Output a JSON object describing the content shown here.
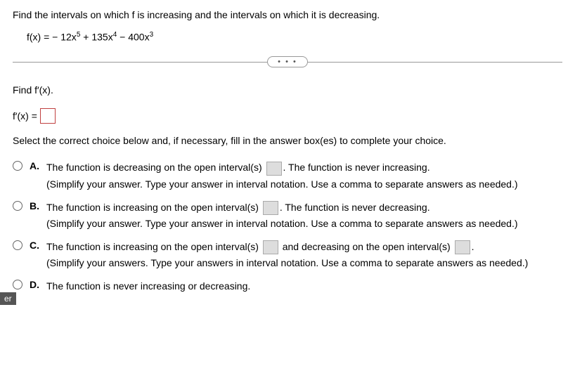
{
  "intro": "Find the intervals on which f is increasing and the intervals on which it is decreasing.",
  "formula_prefix": "f(x) = − 12x",
  "formula_exp1": "5",
  "formula_mid1": " + 135x",
  "formula_exp2": "4",
  "formula_mid2": " − 400x",
  "formula_exp3": "3",
  "divider_dots": "• • •",
  "subq": "Find f′(x).",
  "fprime_label": "f′(x) =",
  "select_instruction": "Select the correct choice below and, if necessary, fill in the answer box(es) to complete your choice.",
  "choices": {
    "a": {
      "label": "A.",
      "line1a": "The function is decreasing on the open interval(s) ",
      "line1b": ". The function is never increasing.",
      "line2": "(Simplify your answer. Type your answer in interval notation. Use a comma to separate answers as needed.)"
    },
    "b": {
      "label": "B.",
      "line1a": "The function is increasing on the open interval(s) ",
      "line1b": ". The function is never decreasing.",
      "line2": "(Simplify your answer. Type your answer in interval notation. Use a comma to separate answers as needed.)"
    },
    "c": {
      "label": "C.",
      "line1a": "The function is increasing on the open interval(s) ",
      "line1b": " and decreasing on the open interval(s) ",
      "line1c": ".",
      "line2": "(Simplify your answers. Type your answers in interval notation. Use a comma to separate answers as needed.)"
    },
    "d": {
      "label": "D.",
      "line1": "The function is never increasing or decreasing."
    }
  },
  "bottom_tag": "er"
}
